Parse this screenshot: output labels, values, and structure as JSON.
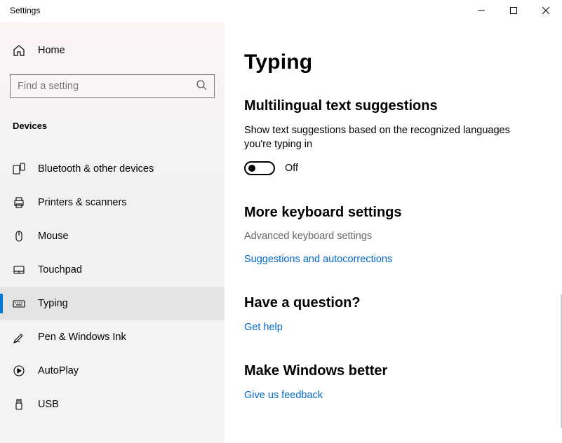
{
  "window": {
    "title": "Settings"
  },
  "sidebar": {
    "home_label": "Home",
    "search_placeholder": "Find a setting",
    "group_header": "Devices",
    "items": [
      {
        "label": "Bluetooth & other devices",
        "icon": "bluetooth-devices-icon",
        "selected": false
      },
      {
        "label": "Printers & scanners",
        "icon": "printer-icon",
        "selected": false
      },
      {
        "label": "Mouse",
        "icon": "mouse-icon",
        "selected": false
      },
      {
        "label": "Touchpad",
        "icon": "touchpad-icon",
        "selected": false
      },
      {
        "label": "Typing",
        "icon": "keyboard-icon",
        "selected": true
      },
      {
        "label": "Pen & Windows Ink",
        "icon": "pen-icon",
        "selected": false
      },
      {
        "label": "AutoPlay",
        "icon": "autoplay-icon",
        "selected": false
      },
      {
        "label": "USB",
        "icon": "usb-icon",
        "selected": false
      }
    ]
  },
  "main": {
    "title": "Typing",
    "sections": {
      "multilingual": {
        "heading": "Multilingual text suggestions",
        "description": "Show text suggestions based on the recognized languages you're typing in",
        "toggle_state": "Off"
      },
      "more_keyboard": {
        "heading": "More keyboard settings",
        "advanced_link": "Advanced keyboard settings",
        "suggestions_link": "Suggestions and autocorrections"
      },
      "question": {
        "heading": "Have a question?",
        "link": "Get help"
      },
      "feedback": {
        "heading": "Make Windows better",
        "link": "Give us feedback"
      }
    }
  }
}
